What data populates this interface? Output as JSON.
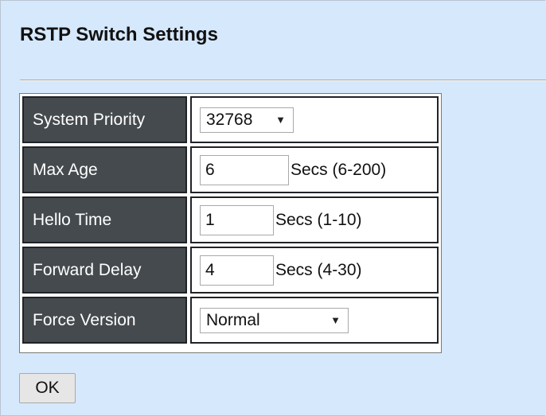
{
  "page": {
    "title": "RSTP Switch Settings"
  },
  "settings": {
    "system_priority": {
      "label": "System Priority",
      "value": "32768"
    },
    "max_age": {
      "label": "Max Age",
      "value": "6",
      "unit": "Secs (6-200)"
    },
    "hello_time": {
      "label": "Hello Time",
      "value": "1",
      "unit": "Secs (1-10)"
    },
    "forward_delay": {
      "label": "Forward Delay",
      "value": "4",
      "unit": "Secs (4-30)"
    },
    "force_version": {
      "label": "Force Version",
      "value": "Normal"
    }
  },
  "actions": {
    "ok_label": "OK"
  },
  "colors": {
    "page_background": "#d6e8fc",
    "label_cell_background": "#454a4e",
    "label_text": "#ffffff"
  }
}
